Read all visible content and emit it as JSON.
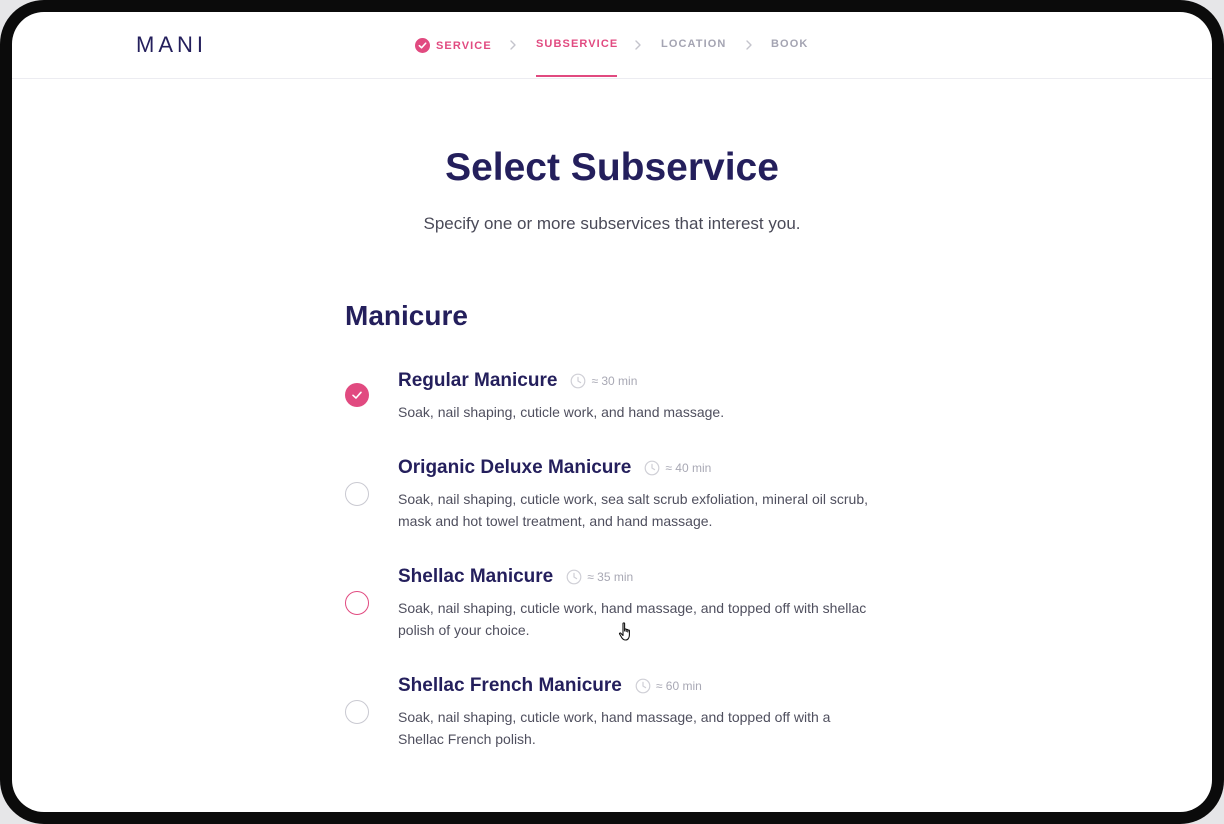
{
  "app": {
    "logo": "MANI"
  },
  "steps": [
    {
      "label": "SERVICE",
      "state": "done"
    },
    {
      "label": "SUBSERVICE",
      "state": "active"
    },
    {
      "label": "LOCATION",
      "state": "pending"
    },
    {
      "label": "BOOK",
      "state": "pending"
    }
  ],
  "page": {
    "title": "Select Subservice",
    "subtitle": "Specify one or more subservices that interest you."
  },
  "section": {
    "title": "Manicure"
  },
  "items": [
    {
      "name": "Regular Manicure",
      "duration": "≈ 30 min",
      "description": "Soak, nail shaping, cuticle work, and hand massage.",
      "selected": true
    },
    {
      "name": "Origanic Deluxe Manicure",
      "duration": "≈ 40 min",
      "description": "Soak, nail shaping, cuticle work, sea salt scrub exfoliation, mineral oil scrub, mask and hot towel treatment, and hand massage.",
      "selected": false
    },
    {
      "name": "Shellac Manicure",
      "duration": "≈ 35 min",
      "description": "Soak, nail shaping, cuticle work, hand massage, and topped off with shellac polish of your choice.",
      "selected": false
    },
    {
      "name": "Shellac French Manicure",
      "duration": "≈ 60 min",
      "description": "Soak, nail shaping, cuticle work, hand massage, and topped off with a Shellac French polish.",
      "selected": false
    }
  ],
  "colors": {
    "accent": "#e14a80",
    "heading": "#241f5c",
    "muted": "#a4a4b2",
    "body_text": "#4f4f5e"
  },
  "icons": {
    "step_done": "check-circle-icon",
    "separator": "chevron-right-icon",
    "duration": "clock-icon",
    "selected": "check-icon"
  }
}
